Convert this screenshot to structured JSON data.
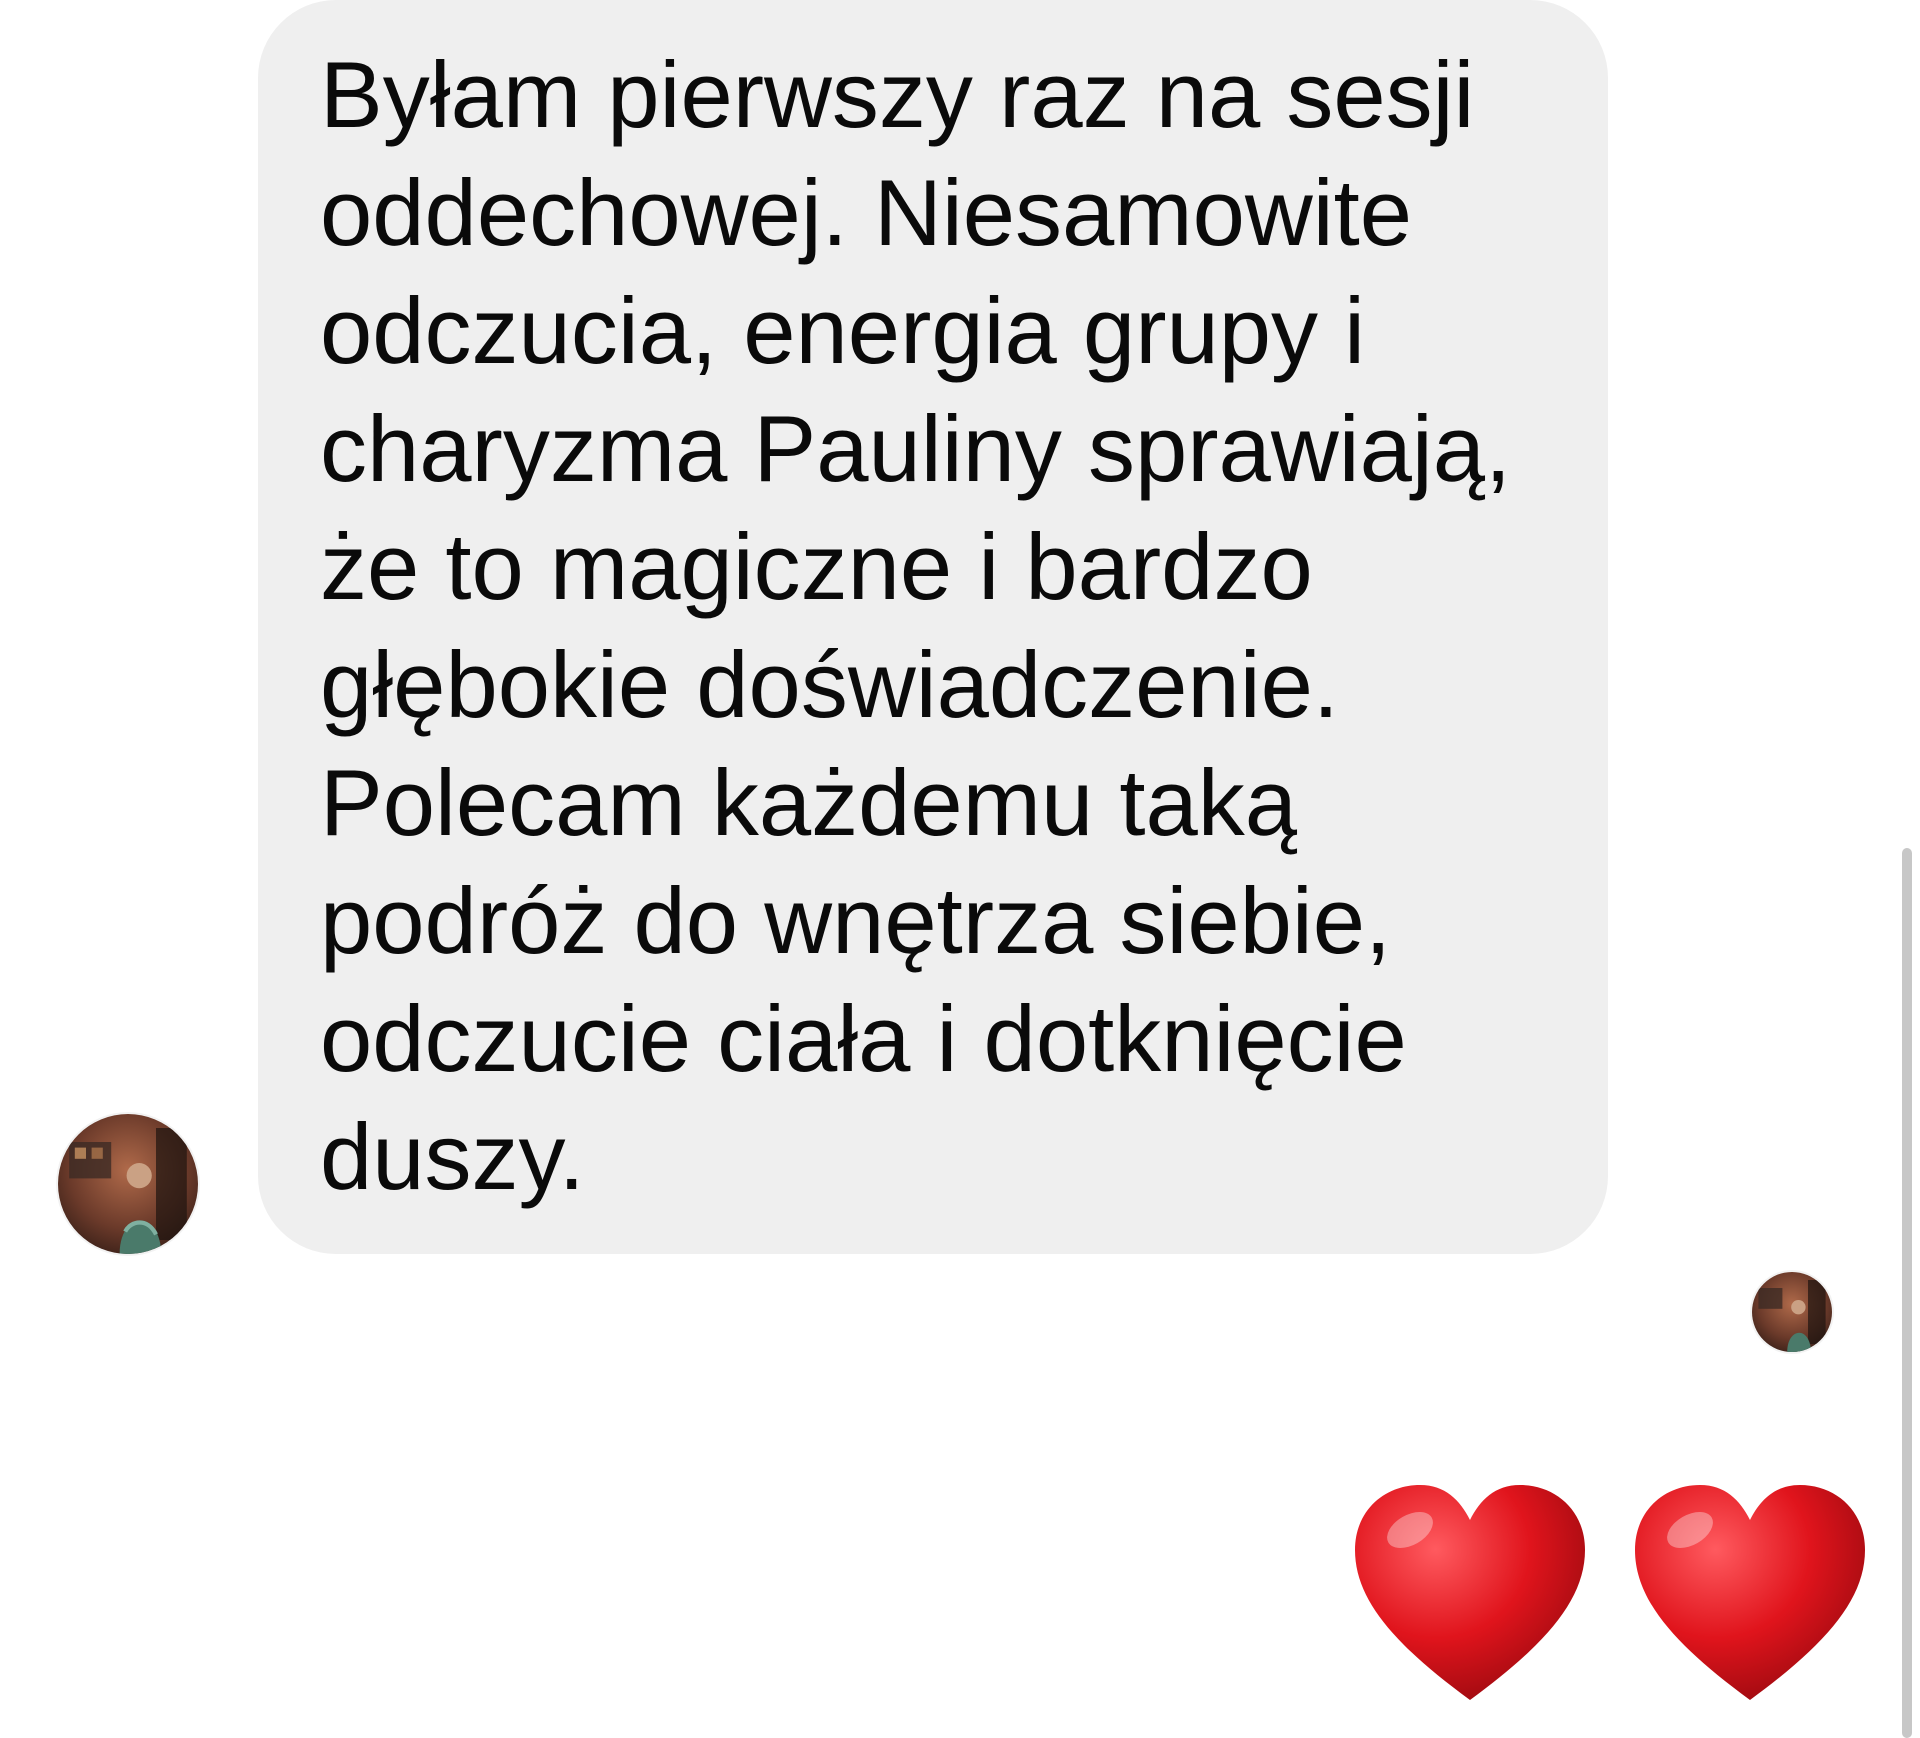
{
  "conversation": {
    "message": {
      "text": "Byłam pierwszy raz na sesji\noddechowej. Niesamowite\nodczucia, energia grupy i\ncharyzma Pauliny sprawiają,\nże to magiczne i bardzo\ngłębokie doświadczenie.\nPolecam każdemu taką\npodróż do wnętrza siebie,\nodczucie ciała i dotknięcie\nduszy.",
      "bubble_color": "#efefef",
      "text_color": "#0a0a0a"
    },
    "sender_avatar": {
      "icon": "profile-photo"
    },
    "read_receipt_avatar": {
      "icon": "profile-photo"
    },
    "reactions": [
      {
        "emoji": "red-heart",
        "color": "#e0141c"
      },
      {
        "emoji": "red-heart",
        "color": "#e0141c"
      }
    ]
  },
  "scrollbar": {
    "color": "#c7c7c7"
  }
}
